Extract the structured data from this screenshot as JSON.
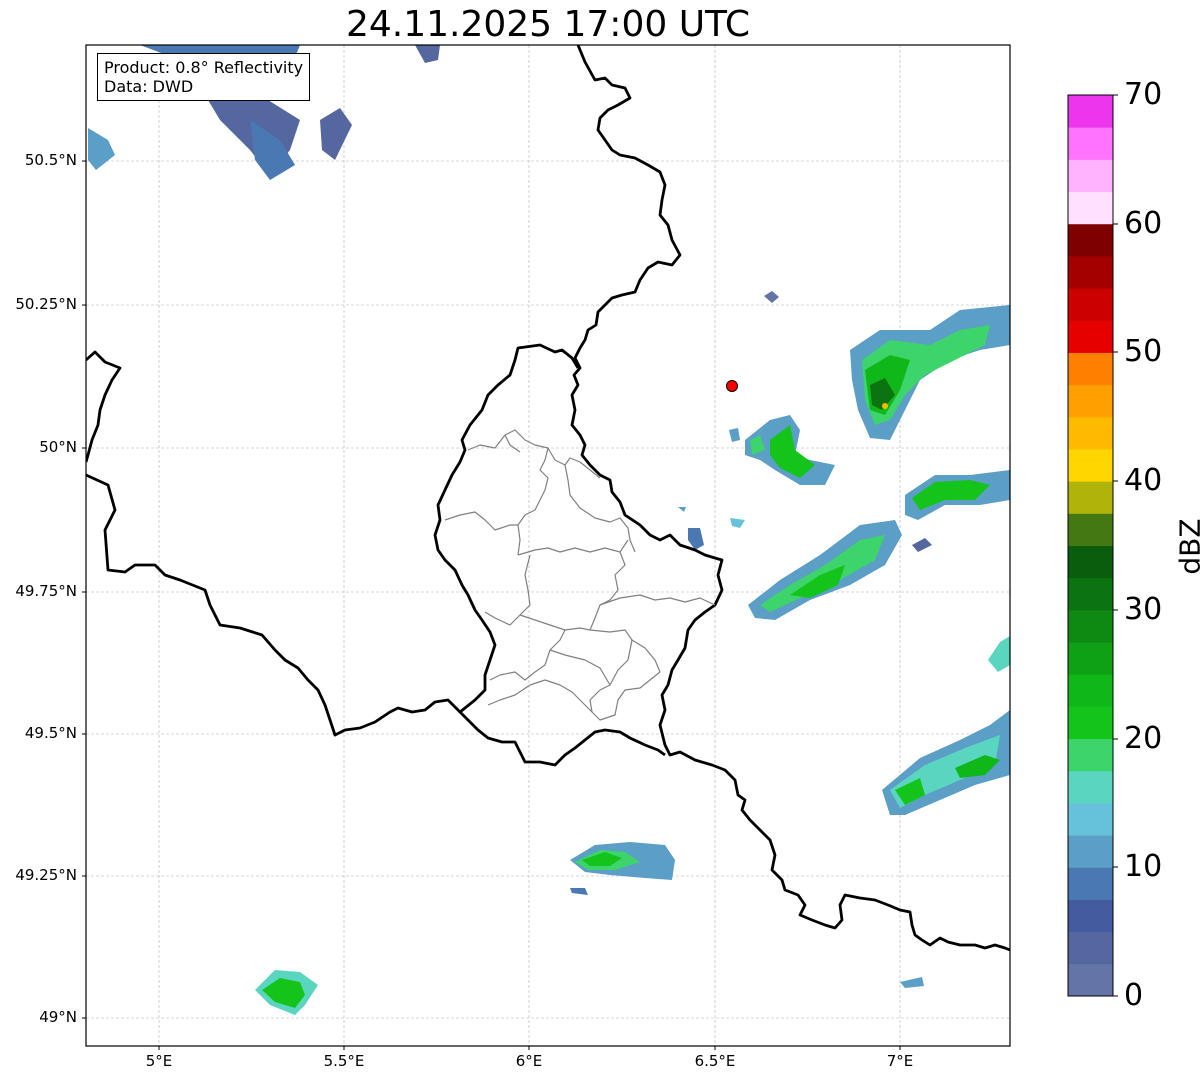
{
  "title": "24.11.2025 17:00 UTC",
  "info": {
    "product": "Product: 0.8° Reflectivity",
    "source": "Data: DWD"
  },
  "axes": {
    "lon_ticks": [
      "5°E",
      "5.5°E",
      "6°E",
      "6.5°E",
      "7°E"
    ],
    "lat_ticks": [
      "50.5°N",
      "50.25°N",
      "50°N",
      "49.75°N",
      "49.5°N",
      "49.25°N",
      "49°N"
    ]
  },
  "marker": {
    "label": "station",
    "color": "#ff0000"
  },
  "colorbar": {
    "label": "dBZ",
    "min": 0,
    "max": 70,
    "ticks": [
      "0",
      "10",
      "20",
      "30",
      "40",
      "50",
      "60",
      "70"
    ],
    "colors": [
      "#6474a6",
      "#54679f",
      "#445ba0",
      "#4a78b2",
      "#5b9ec6",
      "#66c2da",
      "#5ad6c0",
      "#3dd46b",
      "#14c41a",
      "#10b718",
      "#0fa115",
      "#0e8a12",
      "#0c7311",
      "#0b5d0e",
      "#447812",
      "#b0b40a",
      "#ffd600",
      "#ffbb00",
      "#ff9f00",
      "#ff7f00",
      "#e60000",
      "#cc0000",
      "#a50000",
      "#7f0000",
      "#ffe1ff",
      "#ffb3ff",
      "#ff73ff",
      "#ee35ee"
    ]
  },
  "grid": true
}
